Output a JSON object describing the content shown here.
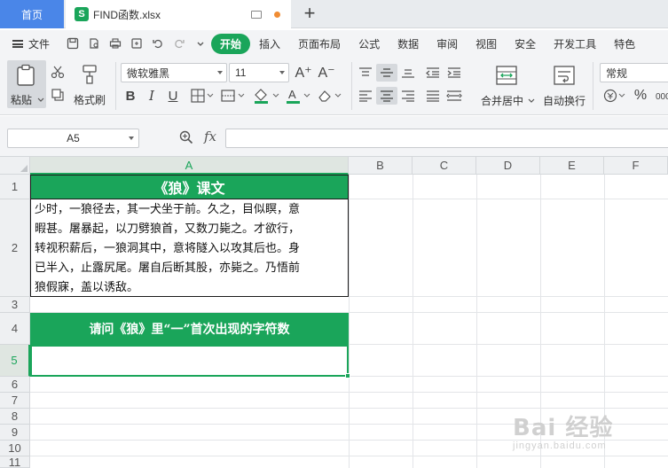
{
  "tabs": {
    "home": "首页",
    "file": "FIND函数.xlsx"
  },
  "menu": {
    "file": "文件",
    "items": [
      "开始",
      "插入",
      "页面布局",
      "公式",
      "数据",
      "审阅",
      "视图",
      "安全",
      "开发工具",
      "特色"
    ],
    "active": "开始"
  },
  "ribbon": {
    "paste": "粘贴",
    "format_painter": "格式刷",
    "font_name": "微软雅黑",
    "font_size": "11",
    "merge_center": "合并居中",
    "wrap_text": "自动换行",
    "number_format": "常规",
    "bold": "B",
    "italic": "I",
    "underline": "U",
    "grow_font": "A⁺",
    "shrink_font": "A⁻"
  },
  "formula_bar": {
    "name_box": "A5",
    "fx": "fx",
    "formula": ""
  },
  "columns": [
    "A",
    "B",
    "C",
    "D",
    "E",
    "F"
  ],
  "rows": [
    "1",
    "2",
    "3",
    "4",
    "5",
    "6",
    "7",
    "8",
    "9",
    "10",
    "11"
  ],
  "cells": {
    "A1": "《狼》课文",
    "A2_lines": [
      "少时，一狼径去，其一犬坐于前。久之，目似瞑，意",
      "暇甚。屠暴起，以刀劈狼首，又数刀毙之。才欲行，",
      "转视积薪后，一狼洞其中，意将隧入以攻其后也。身",
      "已半入，止露尻尾。屠自后断其股，亦毙之。乃悟前",
      "狼假寐，盖以诱敌。"
    ],
    "A4": "请问《狼》里“一”首次出现的字符数",
    "A5": ""
  },
  "watermark": {
    "top": "Bai 经验",
    "bottom": "jingyan.baidu.com"
  },
  "colors": {
    "accent": "#1aa55a",
    "home_tab": "#4a86e8"
  }
}
